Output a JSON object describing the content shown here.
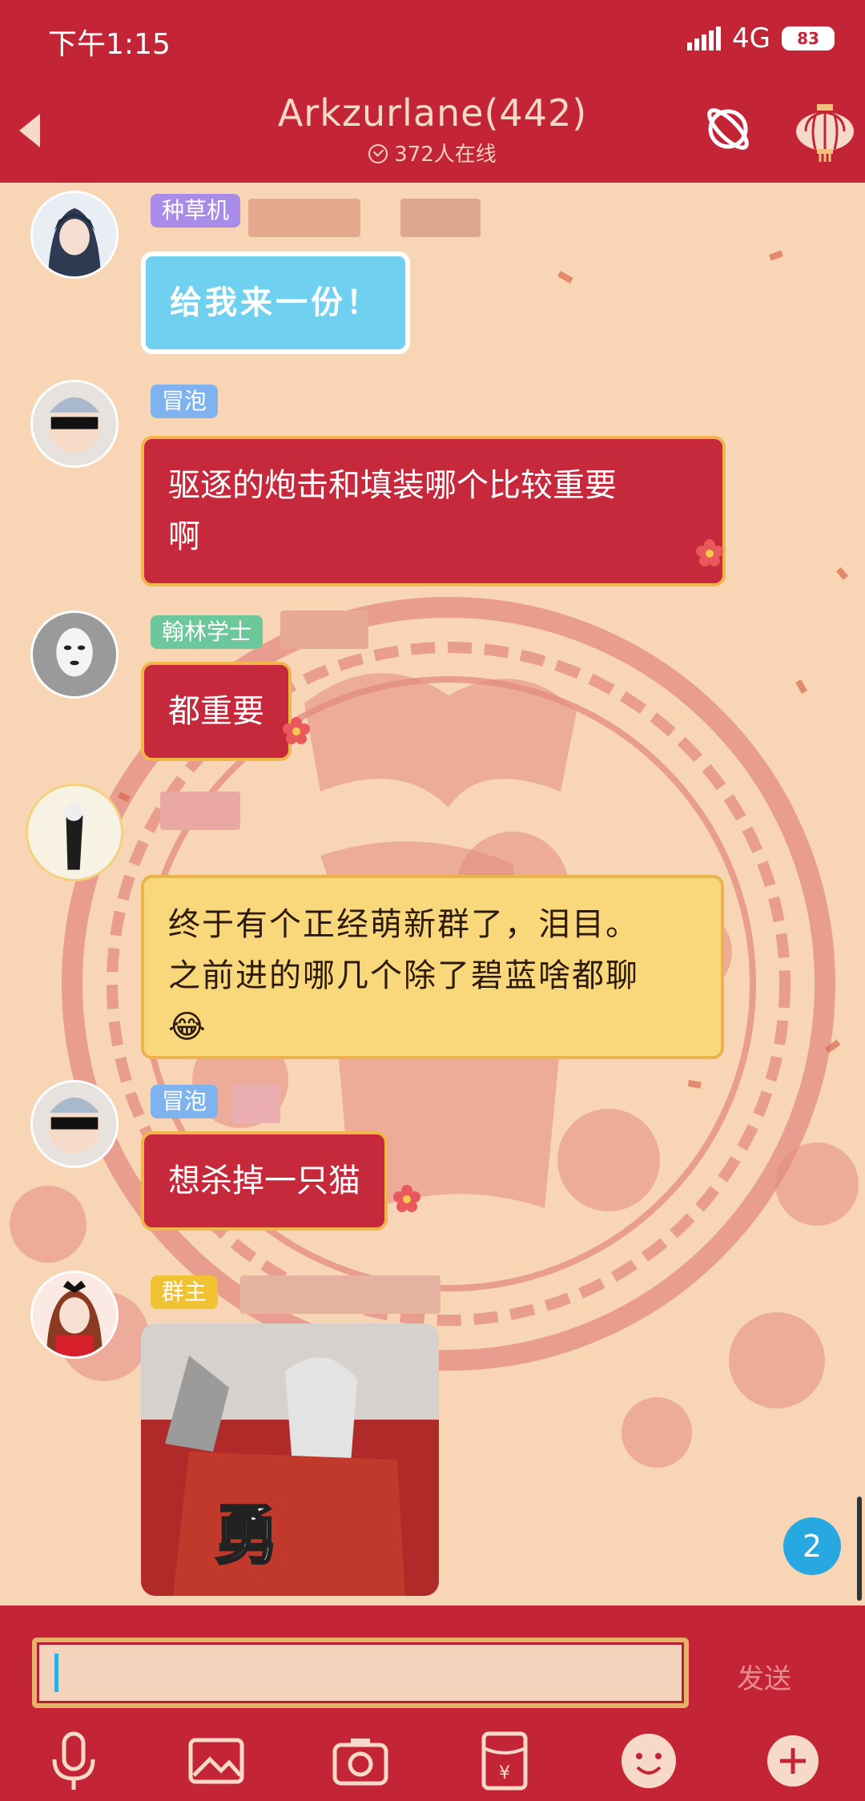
{
  "status_bar": {
    "time": "下午1:15",
    "network": "4G",
    "battery": "83"
  },
  "header": {
    "title": "Arkzurlane(442)",
    "online": "372人在线"
  },
  "messages": [
    {
      "tag": "种草机",
      "tag_color": "#a98ce8",
      "text": "给我来一份！",
      "style": "blue"
    },
    {
      "tag": "冒泡",
      "tag_color": "#7fb3ef",
      "text_line1": "驱逐的炮击和填装哪个比较重要",
      "text_line2": "啊",
      "style": "red"
    },
    {
      "tag": "翰林学士",
      "tag_color": "#6cc89a",
      "text": "都重要",
      "style": "red"
    },
    {
      "tag": "",
      "text_line1": "终于有个正经萌新群了，泪目。",
      "text_line2": "之前进的哪几个除了碧蓝啥都聊",
      "emoji": "😂",
      "style": "yellow"
    },
    {
      "tag": "冒泡",
      "tag_color": "#7fb3ef",
      "text": "想杀掉一只猫",
      "style": "red"
    },
    {
      "tag": "群主",
      "tag_color": "#f1c232",
      "image_caption": "勇",
      "style": "image"
    }
  ],
  "unread_count": "2",
  "composer": {
    "send_label": "发送"
  },
  "toolbar_icons": [
    "microphone-icon",
    "image-icon",
    "camera-icon",
    "red-packet-icon",
    "emoji-icon",
    "plus-icon"
  ],
  "colors": {
    "theme_red": "#c42536",
    "chat_background": "#f7d5b5",
    "bubble_red": "#c6293b",
    "bubble_blue": "#6fd0ef",
    "bubble_yellow": "#f8d87a",
    "unread_badge": "#27a8e0"
  }
}
